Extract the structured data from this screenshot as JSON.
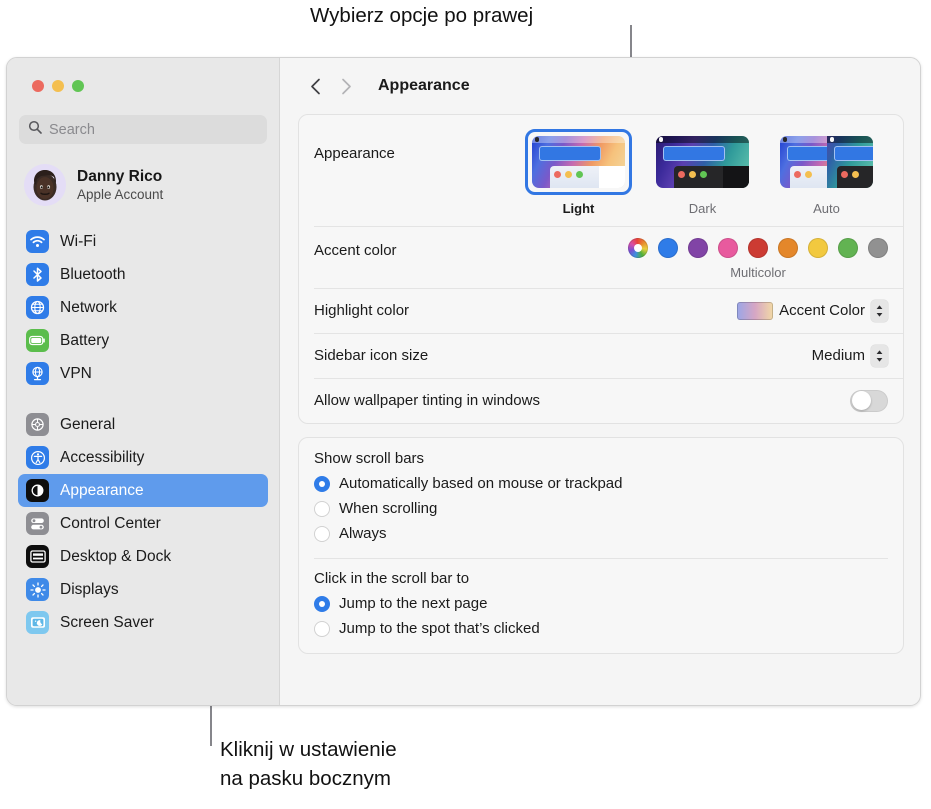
{
  "callouts": {
    "top": "Wybierz opcje po prawej",
    "bottom": "Kliknij w ustawienie\nna pasku bocznym"
  },
  "window": {
    "traffic_lights": [
      "close",
      "minimize",
      "zoom"
    ]
  },
  "sidebar": {
    "search": {
      "placeholder": "Search",
      "value": ""
    },
    "account": {
      "name": "Danny Rico",
      "subtitle": "Apple Account"
    },
    "groups": [
      {
        "items": [
          {
            "label": "Wi-Fi",
            "icon": "wifi-icon",
            "selected": false
          },
          {
            "label": "Bluetooth",
            "icon": "bluetooth-icon",
            "selected": false
          },
          {
            "label": "Network",
            "icon": "network-icon",
            "selected": false
          },
          {
            "label": "Battery",
            "icon": "battery-icon",
            "selected": false
          },
          {
            "label": "VPN",
            "icon": "vpn-icon",
            "selected": false
          }
        ]
      },
      {
        "items": [
          {
            "label": "General",
            "icon": "gear-icon",
            "selected": false
          },
          {
            "label": "Accessibility",
            "icon": "accessibility-icon",
            "selected": false
          },
          {
            "label": "Appearance",
            "icon": "appearance-icon",
            "selected": true
          },
          {
            "label": "Control Center",
            "icon": "control-center-icon",
            "selected": false
          },
          {
            "label": "Desktop & Dock",
            "icon": "desktop-dock-icon",
            "selected": false
          },
          {
            "label": "Displays",
            "icon": "displays-icon",
            "selected": false
          },
          {
            "label": "Screen Saver",
            "icon": "screen-saver-icon",
            "selected": false
          }
        ]
      }
    ]
  },
  "toolbar": {
    "back": "back-icon",
    "forward": "forward-icon",
    "title": "Appearance"
  },
  "main": {
    "appearance": {
      "label": "Appearance",
      "options": [
        {
          "name": "Light",
          "selected": true
        },
        {
          "name": "Dark",
          "selected": false
        },
        {
          "name": "Auto",
          "selected": false
        }
      ]
    },
    "accent_color": {
      "label": "Accent color",
      "caption": "Multicolor",
      "selected_index": 0,
      "swatches": [
        {
          "name": "Multicolor",
          "color": "multicolor"
        },
        {
          "name": "Blue",
          "color": "#2f7ce8"
        },
        {
          "name": "Purple",
          "color": "#8144a6"
        },
        {
          "name": "Pink",
          "color": "#e85a9e"
        },
        {
          "name": "Red",
          "color": "#cc3b33"
        },
        {
          "name": "Orange",
          "color": "#e4872a"
        },
        {
          "name": "Yellow",
          "color": "#f2c93f"
        },
        {
          "name": "Green",
          "color": "#62b352"
        },
        {
          "name": "Graphite",
          "color": "#919191"
        }
      ]
    },
    "highlight_color": {
      "label": "Highlight color",
      "value": "Accent Color"
    },
    "sidebar_icon_size": {
      "label": "Sidebar icon size",
      "value": "Medium"
    },
    "wallpaper_tinting": {
      "label": "Allow wallpaper tinting in windows",
      "enabled": false
    },
    "show_scroll_bars": {
      "title": "Show scroll bars",
      "options": [
        {
          "label": "Automatically based on mouse or trackpad",
          "selected": true
        },
        {
          "label": "When scrolling",
          "selected": false
        },
        {
          "label": "Always",
          "selected": false
        }
      ]
    },
    "click_scroll_bar": {
      "title": "Click in the scroll bar to",
      "options": [
        {
          "label": "Jump to the next page",
          "selected": true
        },
        {
          "label": "Jump to the spot that’s clicked",
          "selected": false
        }
      ]
    }
  }
}
